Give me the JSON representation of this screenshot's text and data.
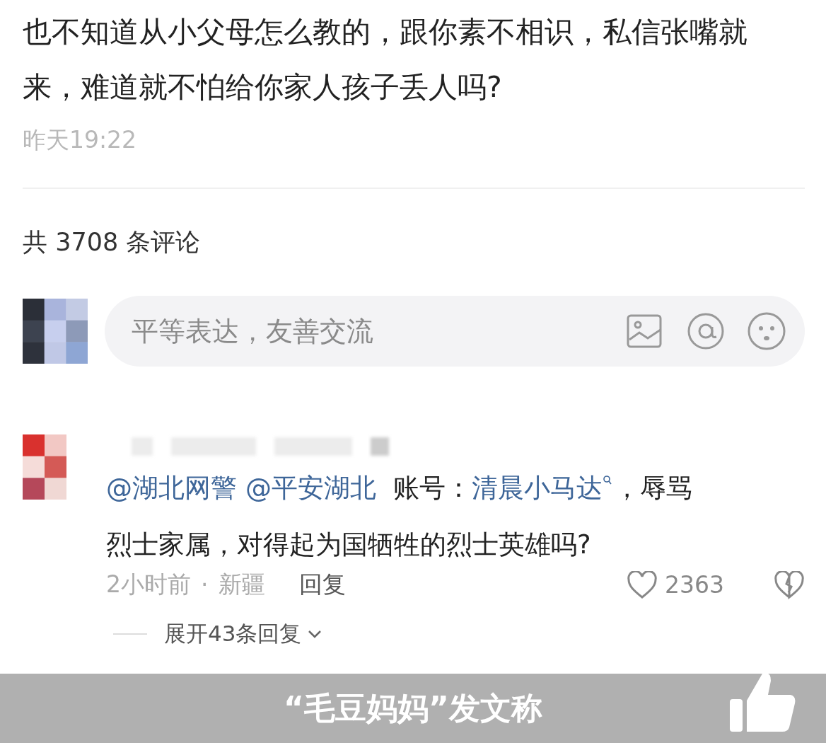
{
  "post": {
    "text_lines": [
      "也不知道从小父母怎么教的，跟你素不相识，私信张嘴就",
      "来，难道就不怕给你家人孩子丢人吗?"
    ],
    "time": "昨天19:22"
  },
  "comment_count": "共 3708 条评论",
  "composer": {
    "placeholder": "平等表达，友善交流"
  },
  "comments": [
    {
      "segments": [
        {
          "kind": "mention",
          "text": "@湖北网警"
        },
        {
          "kind": "mention",
          "text": "@平安湖北"
        },
        {
          "kind": "text",
          "text": " 账号："
        },
        {
          "kind": "link",
          "text": "清晨小马达"
        },
        {
          "kind": "text",
          "text": "，辱骂烈士家属，对得起为国牺牲的烈士英雄吗?"
        }
      ],
      "time": "2小时前",
      "separator": "·",
      "location": "新疆",
      "reply": "回复",
      "likes": "2363",
      "expand": "展开43条回复"
    }
  ],
  "caption": "“毛豆妈妈”发文称"
}
